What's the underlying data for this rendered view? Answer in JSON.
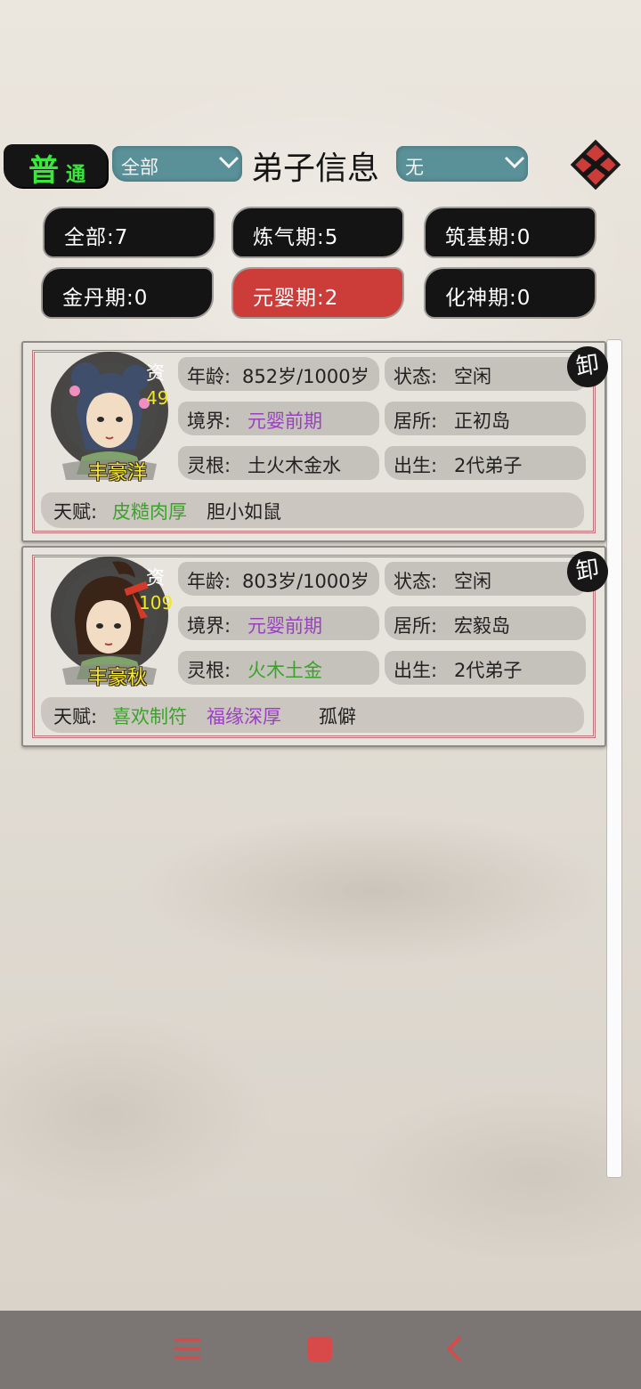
{
  "header": {
    "mode_big": "普",
    "mode_small": "通",
    "filter1": "全部",
    "title": "弟子信息",
    "filter2": "无"
  },
  "tabs": [
    {
      "label": "全部:7"
    },
    {
      "label": "炼气期:5"
    },
    {
      "label": "筑基期:0"
    },
    {
      "label": "金丹期:0"
    },
    {
      "label": "元婴期:2",
      "active": true
    },
    {
      "label": "化神期:0"
    }
  ],
  "disciples": [
    {
      "name": "丰豪洋",
      "zi": "资",
      "aptitude": "49",
      "age_label": "年龄:",
      "age": "852岁/1000岁",
      "status_label": "状态:",
      "status": "空闲",
      "realm_label": "境界:",
      "realm": "元婴前期",
      "residence_label": "居所:",
      "residence": "正初岛",
      "root_label": "灵根:",
      "root": "土火木金水",
      "origin_label": "出生:",
      "origin": "2代弟子",
      "talent_label": "天赋:",
      "talents": [
        "皮糙肉厚",
        "胆小如鼠"
      ],
      "seal": "卸"
    },
    {
      "name": "丰豪秋",
      "zi": "资",
      "aptitude": "109",
      "age_label": "年龄:",
      "age": "803岁/1000岁",
      "status_label": "状态:",
      "status": "空闲",
      "realm_label": "境界:",
      "realm": "元婴前期",
      "residence_label": "居所:",
      "residence": "宏毅岛",
      "root_label": "灵根:",
      "root": "火木土金",
      "origin_label": "出生:",
      "origin": "2代弟子",
      "talent_label": "天赋:",
      "talents": [
        "喜欢制符",
        "福缘深厚",
        "孤僻"
      ],
      "seal": "卸"
    }
  ],
  "colors": {
    "active_tab": "#cc3d3a",
    "dropdown": "#5a9098",
    "mode_text": "#39e83a",
    "realm_purple": "#9a40c0",
    "green_text": "#3da22c",
    "name_yellow": "#f5ea3a"
  },
  "icons": {
    "close": "close-x-icon",
    "nav_menu": "menu-icon",
    "nav_home": "home-icon",
    "nav_back": "back-icon"
  }
}
